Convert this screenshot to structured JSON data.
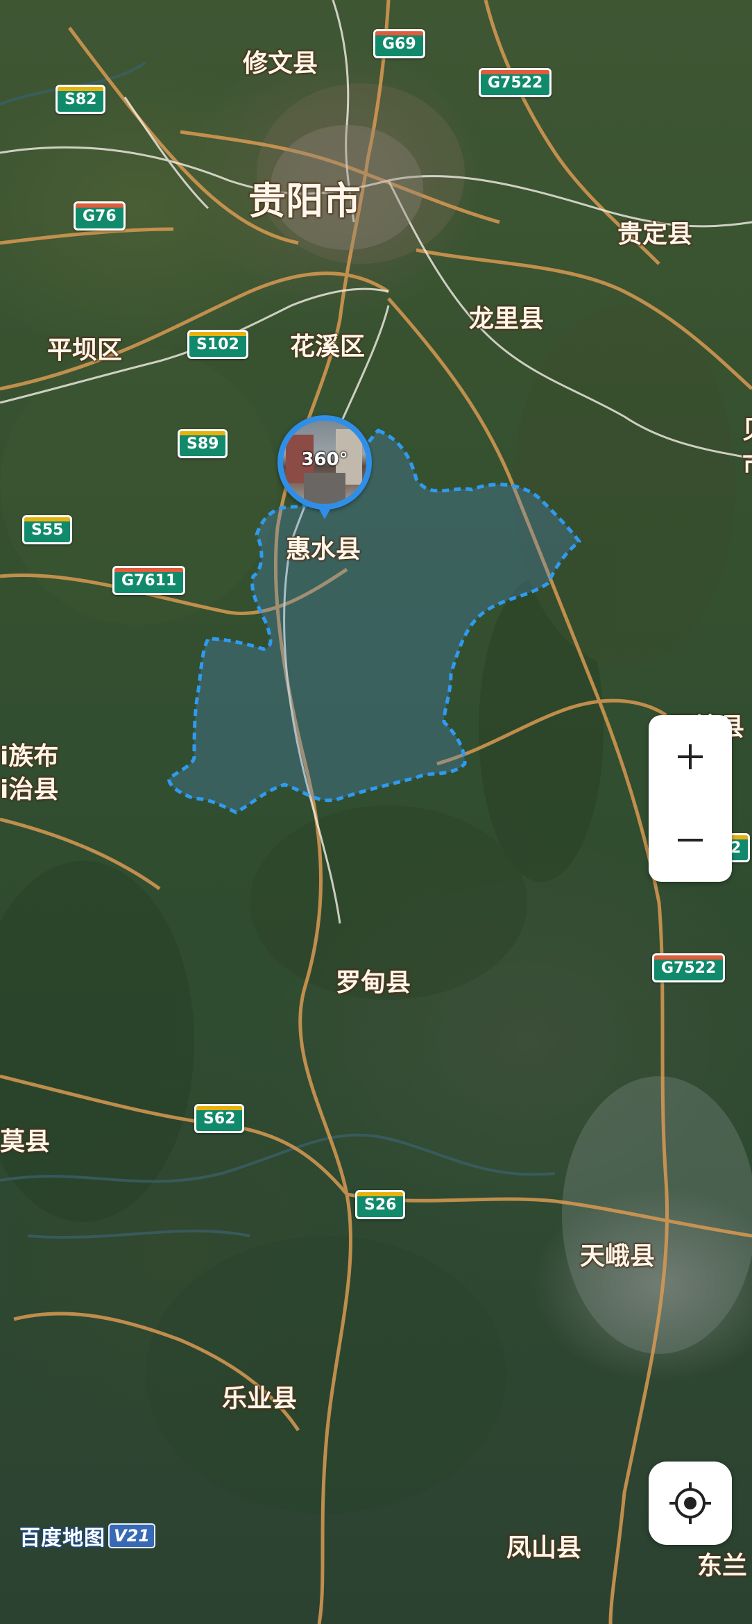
{
  "map": {
    "provider_logo": "百度地图",
    "provider_version": "V21",
    "layer": "satellite",
    "selected_region": "惠水县",
    "selected_region_style": {
      "fill": "#4f8fd9",
      "border": "#2f9bf0"
    },
    "pin": {
      "badge": "360°",
      "kind": "panorama-pin",
      "color": "#2f8fe8"
    }
  },
  "places": {
    "xiuwen": "修文县",
    "guiyang": "贵阳市",
    "guiding": "贵定县",
    "pingba": "平坝区",
    "huaxi": "花溪区",
    "longli": "龙里县",
    "huishui": "惠水县",
    "luodian": "罗甸县",
    "tiane": "天峨县",
    "leye": "乐业县",
    "fengshan": "凤山县",
    "donglan_partial": "东兰",
    "zhenning_partial_1": "i族布",
    "zhenning_partial_2": "i治县",
    "wangmo_partial": "莫县",
    "pingtang_partial": "平塘县",
    "duyun_partial": "贝",
    "duyun_partial_2": "市"
  },
  "roads": {
    "g69": "G69",
    "s82": "S82",
    "g7522_top": "G7522",
    "g76": "G76",
    "s102": "S102",
    "s89": "S89",
    "s55": "S55",
    "g7611": "G7611",
    "g7522_mid": "G7522",
    "s62": "S62",
    "s26": "S26",
    "partial_right": "2"
  },
  "controls": {
    "zoom_in": "+",
    "zoom_out": "−",
    "locate_icon": "crosshair-locate-icon"
  }
}
